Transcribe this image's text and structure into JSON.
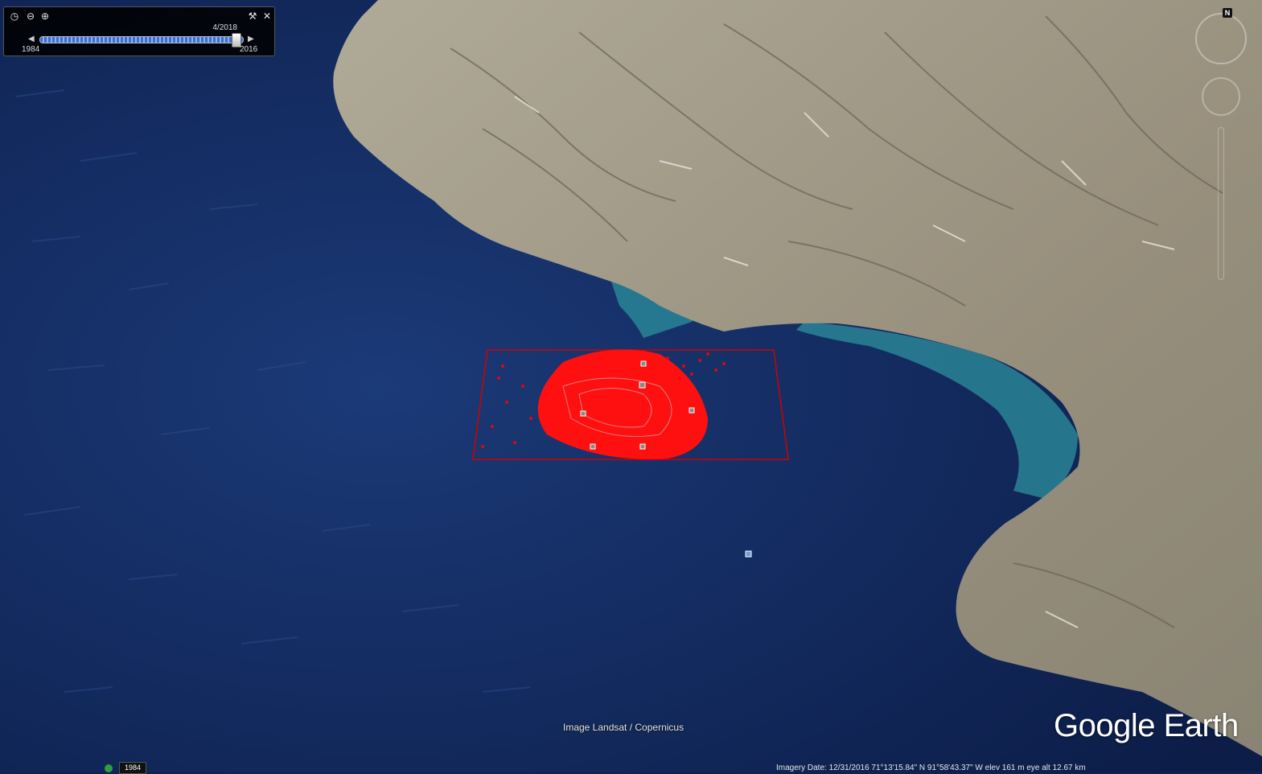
{
  "time_slider": {
    "current_date": "4/2018",
    "start_year": "1984",
    "end_year": "2016",
    "position": 0.97,
    "buttons": [
      "clock-icon",
      "zoom-out-icon",
      "zoom-in-icon",
      "wrench-icon",
      "close-icon"
    ]
  },
  "navigation": {
    "north_label": "N"
  },
  "map": {
    "attribution": "Image Landsat / Copernicus",
    "logo": "Google Earth",
    "colors": {
      "ocean": "#0f2350",
      "land": "#a09a88",
      "shallow_water": "#2a8a9a",
      "overlay": "#ff0000"
    }
  },
  "status_bar": {
    "year_badge": "1984",
    "readout": "Imagery Date: 12/31/2016      71°13'15.84\" N    91°58'43.37\" W   elev   161 m     eye alt  12.67 km"
  }
}
